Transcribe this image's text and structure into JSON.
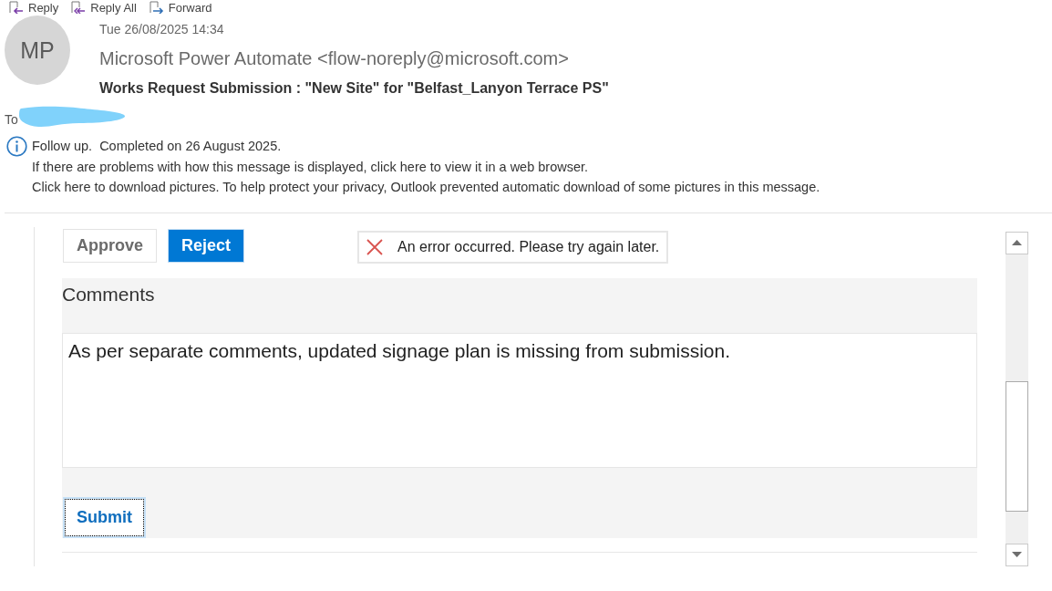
{
  "toolbar": [
    {
      "kind": "reply",
      "label": "Reply"
    },
    {
      "kind": "reply_all",
      "label": "Reply All"
    },
    {
      "kind": "forward",
      "label": "Forward"
    }
  ],
  "message": {
    "avatar_initials": "MP",
    "date": "Tue 26/08/2025 14:34",
    "sender": "Microsoft Power Automate <flow-noreply@microsoft.com>",
    "subject": "Works Request Submission : \"New Site\" for \"Belfast_Lanyon Terrace PS\"",
    "to_label": "To"
  },
  "infobar": {
    "lines": [
      "Follow up.  Completed on 26 August 2025.",
      "If there are problems with how this message is displayed, click here to view it in a web browser.",
      "Click here to download pictures. To help protect your privacy, Outlook prevented automatic download of some pictures in this message."
    ]
  },
  "card": {
    "actions": [
      {
        "label": "Approve",
        "selected": false
      },
      {
        "label": "Reject",
        "selected": true
      }
    ],
    "error": "An error occurred. Please try again later.",
    "comments_label": "Comments",
    "comments_value": "As per separate comments, updated signage plan is missing from submission.",
    "submit": {
      "label": "Submit",
      "focused": true
    }
  }
}
